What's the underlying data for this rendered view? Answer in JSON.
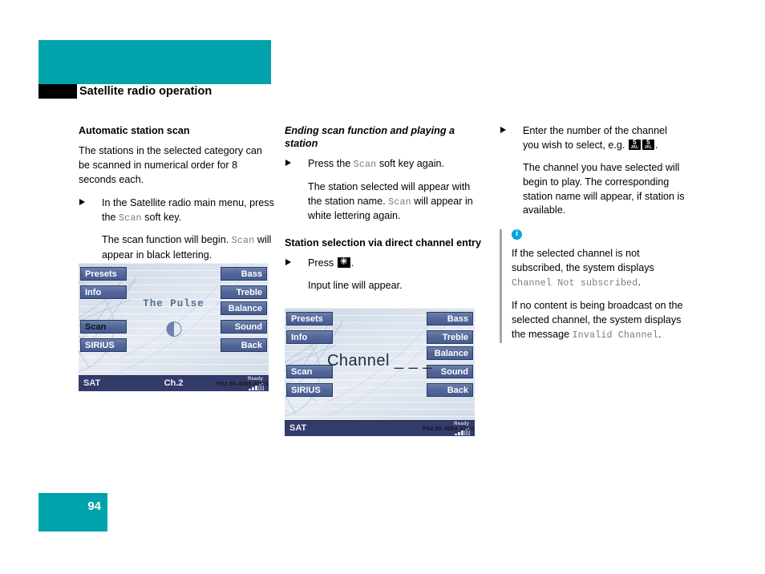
{
  "header": {
    "band_title": "Satellite radio",
    "sub_title": "Satellite radio operation"
  },
  "footer": {
    "page_number": "94"
  },
  "colors": {
    "teal": "#00a3ab",
    "softkey_blue": "#53679a",
    "statusbar_navy": "#333b6b",
    "info_blue": "#0aa3dd",
    "mono_gray": "#7b7b7b"
  },
  "col1": {
    "heading": "Automatic station scan",
    "intro": "The stations in the selected category can be scanned in numerical order for 8 seconds each.",
    "step1_a": "In the Satellite radio main menu, press the ",
    "step1_key": "Scan",
    "step1_b": " soft key.",
    "step1_result_a": "The scan function will begin. ",
    "step1_result_key": "Scan",
    "step1_result_b": " will appear in black lettering."
  },
  "col2": {
    "heading": "Ending scan function and playing a station",
    "step1_a": "Press the ",
    "step1_key": "Scan",
    "step1_b": " soft key again.",
    "step1_result_a": "The station selected will appear with the station name. ",
    "step1_result_key": "Scan",
    "step1_result_b": " will appear in white lettering again.",
    "heading2": "Station selection via direct channel entry",
    "step2_a": "Press ",
    "step2_key_glyph": "✳",
    "step2_b": ".",
    "step2_result": "Input line will appear."
  },
  "col3": {
    "step1_a": "Enter the number of the channel you wish to select, e.g. ",
    "step1_key1_num": "5",
    "step1_key1_sub": "JKL",
    "step1_key2_num": "5",
    "step1_key2_sub": "JKL",
    "step1_b": ".",
    "step1_result": "The channel you have selected will begin to play. The corresponding station name will appear, if station is available.",
    "note_icon": "info-icon",
    "note1_a": "If the selected channel is not subscribed, the system displays ",
    "note1_mono": "Channel Not subscribed",
    "note1_b": ".",
    "note2_a": "If no content is being broadcast on the selected channel, the system displays the message ",
    "note2_mono": "Invalid Channel",
    "note2_b": "."
  },
  "radio1": {
    "softkeys_left": [
      "Presets",
      "Info",
      "Scan",
      "SIRIUS"
    ],
    "softkeys_right": [
      "Bass",
      "Treble",
      "Balance",
      "Sound",
      "Back"
    ],
    "active_softkey": "Scan",
    "station_name": "The Pulse",
    "status_sat": "SAT",
    "status_channel": "Ch.2",
    "status_ready": "Ready",
    "caption": "P82.86-4085-31US"
  },
  "radio2": {
    "softkeys_left": [
      "Presets",
      "Info",
      "Scan",
      "SIRIUS"
    ],
    "softkeys_right": [
      "Bass",
      "Treble",
      "Balance",
      "Sound",
      "Back"
    ],
    "channel_prompt": "Channel _ _ _",
    "status_sat": "SAT",
    "status_channel": "",
    "status_ready": "Ready",
    "caption": "P82.86-4084-31US"
  }
}
